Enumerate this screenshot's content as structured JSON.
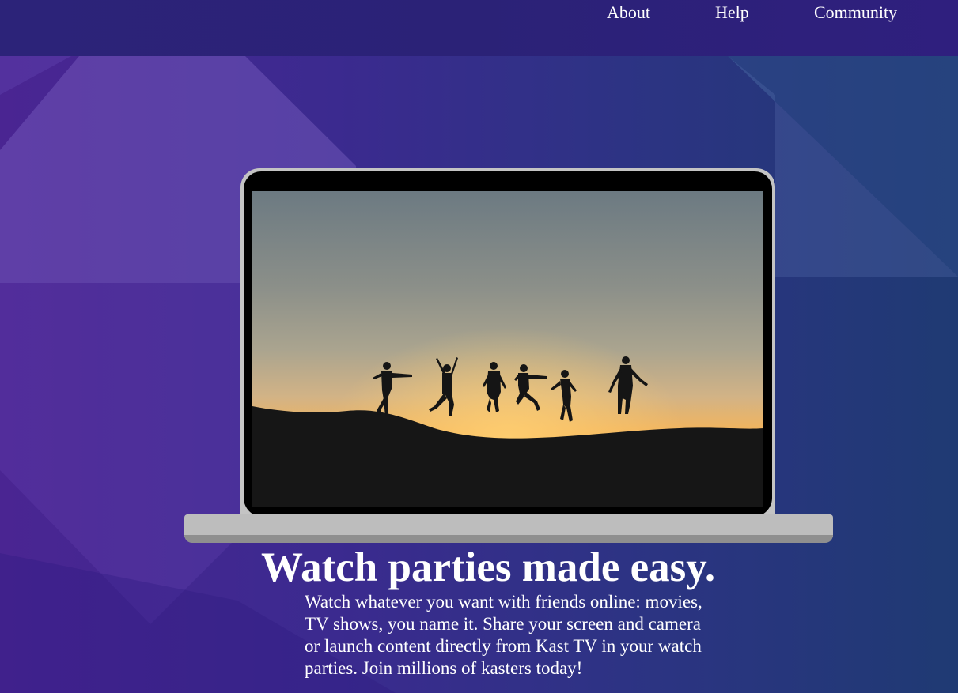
{
  "nav": {
    "links": [
      {
        "label": "About"
      },
      {
        "label": "Help"
      },
      {
        "label": "Community"
      }
    ]
  },
  "hero": {
    "title": "Watch parties made easy.",
    "description": "Watch whatever you want with friends online: movies, TV shows, you name it. Share your screen and camera or launch content directly from Kast TV in your watch parties. Join millions of kasters today!"
  },
  "colors": {
    "background_left": "#4a2592",
    "background_right": "#1f3a73",
    "navbar": "#2c2379",
    "text": "#ffffff",
    "laptop_frame": "#c4c4c4"
  }
}
